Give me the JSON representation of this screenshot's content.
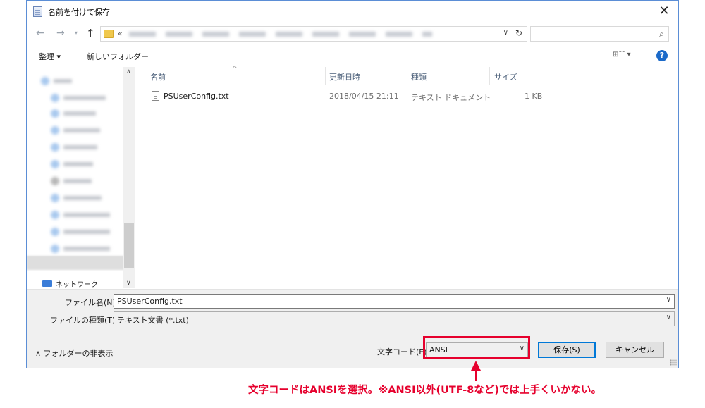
{
  "window": {
    "title": "名前を付けて保存",
    "close_label": "✕"
  },
  "addressbar": {
    "chevron": "«",
    "path": "",
    "search_placeholder": ""
  },
  "toolbar": {
    "organize": "整理 ▾",
    "new_folder": "新しいフォルダー",
    "view": "⊞☷ ▾",
    "help": "?"
  },
  "navpane": {
    "network": "ネットワーク"
  },
  "filelist": {
    "columns": [
      "名前",
      "更新日時",
      "種類",
      "サイズ"
    ],
    "rows": [
      {
        "name": "PSUserConfig.txt",
        "date": "2018/04/15 21:11",
        "type": "テキスト ドキュメント",
        "size": "1 KB"
      }
    ]
  },
  "form": {
    "filename_label": "ファイル名(N):",
    "filename_value": "PSUserConfig.txt",
    "filetype_label": "ファイルの種類(T):",
    "filetype_value": "テキスト文書 (*.txt)",
    "encoding_label": "文字コード(E):",
    "encoding_value": "ANSI",
    "save_button": "保存(S)",
    "cancel_button": "キャンセル",
    "hide_folders": "∧ フォルダーの非表示"
  },
  "annotation": {
    "note": "文字コードはANSIを選択。※ANSI以外(UTF-8など)では上手くいかない。",
    "accent": "#e6002d"
  }
}
